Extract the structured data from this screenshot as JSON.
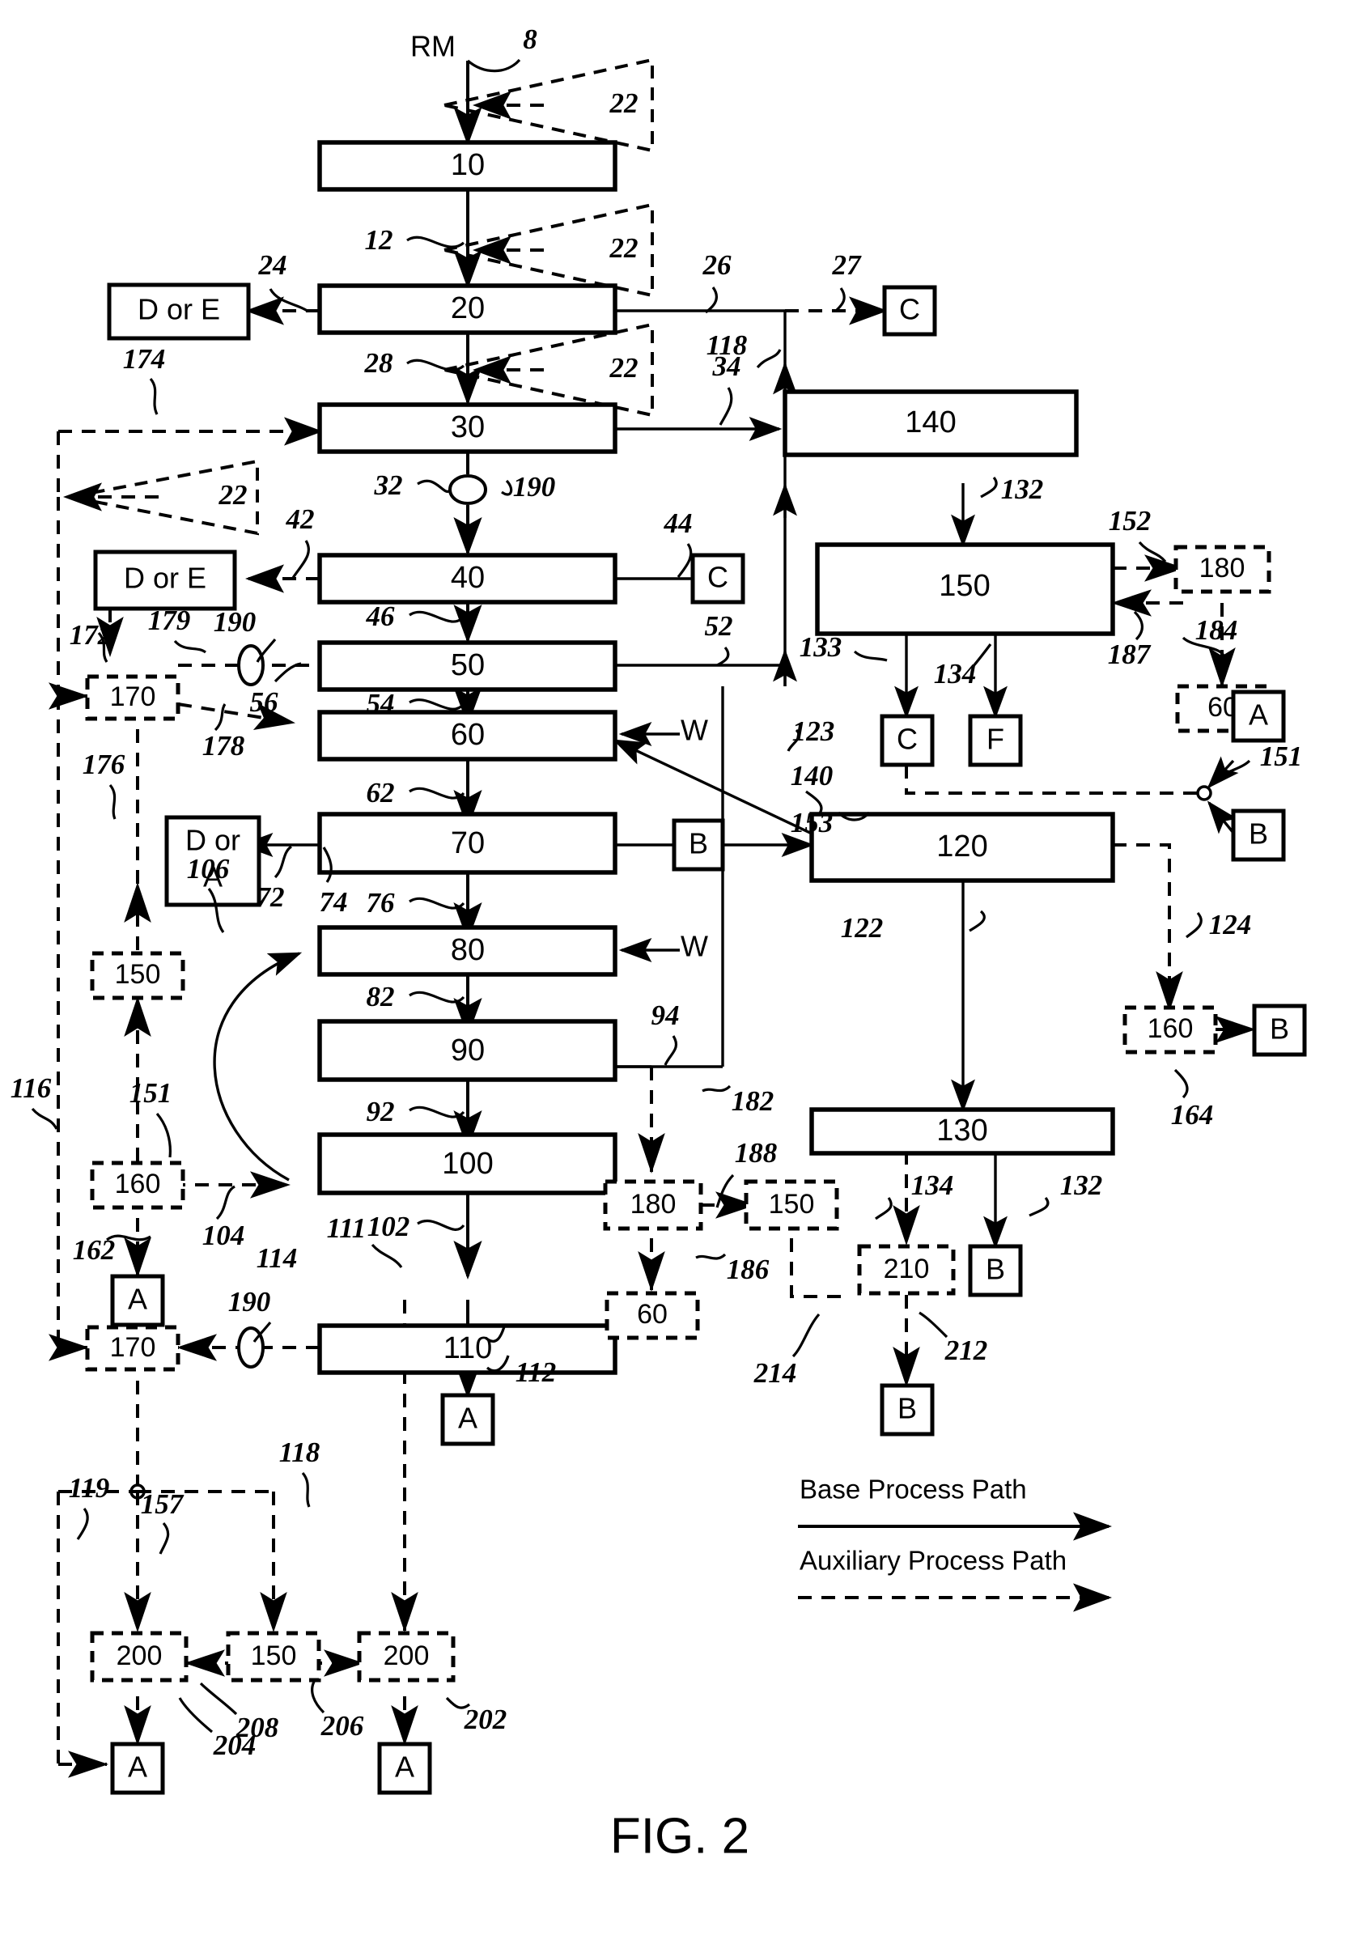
{
  "figure": {
    "caption": "FIG. 2",
    "input_label": "RM"
  },
  "legend": {
    "base_path": "Base Process Path",
    "auxiliary_path": "Auxiliary Process Path"
  },
  "process_boxes": [
    {
      "id": "box-10",
      "label": "10"
    },
    {
      "id": "box-20",
      "label": "20"
    },
    {
      "id": "box-30",
      "label": "30"
    },
    {
      "id": "box-40",
      "label": "40"
    },
    {
      "id": "box-50",
      "label": "50"
    },
    {
      "id": "box-60",
      "label": "60"
    },
    {
      "id": "box-70",
      "label": "70"
    },
    {
      "id": "box-80",
      "label": "80"
    },
    {
      "id": "box-90",
      "label": "90"
    },
    {
      "id": "box-100",
      "label": "100"
    },
    {
      "id": "box-110",
      "label": "110"
    },
    {
      "id": "box-120",
      "label": "120"
    },
    {
      "id": "box-130",
      "label": "130"
    },
    {
      "id": "box-140",
      "label": "140"
    },
    {
      "id": "box-150",
      "label": "150"
    }
  ],
  "dashed_boxes": [
    {
      "id": "dbox-170-upper",
      "label": "170"
    },
    {
      "id": "dbox-170-lower",
      "label": "170"
    },
    {
      "id": "dbox-180-right",
      "label": "180"
    },
    {
      "id": "dbox-180-mid",
      "label": "180"
    },
    {
      "id": "dbox-60-right",
      "label": "60"
    },
    {
      "id": "dbox-60-mid",
      "label": "60"
    },
    {
      "id": "dbox-150-left",
      "label": "150"
    },
    {
      "id": "dbox-150-mid",
      "label": "150"
    },
    {
      "id": "dbox-150-bottom",
      "label": "150"
    },
    {
      "id": "dbox-160-left",
      "label": "160"
    },
    {
      "id": "dbox-160-right",
      "label": "160"
    },
    {
      "id": "dbox-200-left",
      "label": "200"
    },
    {
      "id": "dbox-200-right",
      "label": "200"
    },
    {
      "id": "dbox-210",
      "label": "210"
    }
  ],
  "terminal_boxes": [
    {
      "id": "term-c-top",
      "label": "C"
    },
    {
      "id": "term-c-40",
      "label": "C"
    },
    {
      "id": "term-c-150",
      "label": "C"
    },
    {
      "id": "term-f-150",
      "label": "F"
    },
    {
      "id": "term-b-70",
      "label": "B"
    },
    {
      "id": "term-b-151",
      "label": "B"
    },
    {
      "id": "term-b-160",
      "label": "B"
    },
    {
      "id": "term-b-130",
      "label": "B"
    },
    {
      "id": "term-b-210",
      "label": "B"
    },
    {
      "id": "term-a-151",
      "label": "A"
    },
    {
      "id": "term-a-160left",
      "label": "A"
    },
    {
      "id": "term-a-110",
      "label": "A"
    },
    {
      "id": "term-a-200left",
      "label": "A"
    },
    {
      "id": "term-a-200right",
      "label": "A"
    },
    {
      "id": "term-dore-20",
      "label": "D or E"
    },
    {
      "id": "term-dore-40",
      "label": "D or E"
    },
    {
      "id": "term-dora-70",
      "label": "D or A"
    }
  ],
  "water_labels": [
    {
      "id": "water-60",
      "label": "W"
    },
    {
      "id": "water-80",
      "label": "W"
    }
  ],
  "triangles_22": [
    {
      "id": "tri-22-a",
      "label": "22"
    },
    {
      "id": "tri-22-b",
      "label": "22"
    },
    {
      "id": "tri-22-c",
      "label": "22"
    },
    {
      "id": "tri-22-d",
      "label": "22"
    }
  ],
  "reference_numerals": [
    {
      "id": "ref-8",
      "label": "8"
    },
    {
      "id": "ref-12",
      "label": "12"
    },
    {
      "id": "ref-24",
      "label": "24"
    },
    {
      "id": "ref-26",
      "label": "26"
    },
    {
      "id": "ref-27",
      "label": "27"
    },
    {
      "id": "ref-28",
      "label": "28"
    },
    {
      "id": "ref-32",
      "label": "32"
    },
    {
      "id": "ref-34",
      "label": "34"
    },
    {
      "id": "ref-42",
      "label": "42"
    },
    {
      "id": "ref-44",
      "label": "44"
    },
    {
      "id": "ref-46",
      "label": "46"
    },
    {
      "id": "ref-52",
      "label": "52"
    },
    {
      "id": "ref-54",
      "label": "54"
    },
    {
      "id": "ref-56",
      "label": "56"
    },
    {
      "id": "ref-62",
      "label": "62"
    },
    {
      "id": "ref-72",
      "label": "72"
    },
    {
      "id": "ref-74",
      "label": "74"
    },
    {
      "id": "ref-76",
      "label": "76"
    },
    {
      "id": "ref-82",
      "label": "82"
    },
    {
      "id": "ref-92",
      "label": "92"
    },
    {
      "id": "ref-94",
      "label": "94"
    },
    {
      "id": "ref-102",
      "label": "102"
    },
    {
      "id": "ref-104",
      "label": "104"
    },
    {
      "id": "ref-106",
      "label": "106"
    },
    {
      "id": "ref-111",
      "label": "111"
    },
    {
      "id": "ref-112",
      "label": "112"
    },
    {
      "id": "ref-114",
      "label": "114"
    },
    {
      "id": "ref-116",
      "label": "116"
    },
    {
      "id": "ref-118-top",
      "label": "118"
    },
    {
      "id": "ref-118-bot",
      "label": "118"
    },
    {
      "id": "ref-119",
      "label": "119"
    },
    {
      "id": "ref-122",
      "label": "122"
    },
    {
      "id": "ref-123",
      "label": "123"
    },
    {
      "id": "ref-124",
      "label": "124"
    },
    {
      "id": "ref-132-top",
      "label": "132"
    },
    {
      "id": "ref-132-bot",
      "label": "132"
    },
    {
      "id": "ref-133",
      "label": "133"
    },
    {
      "id": "ref-134-top",
      "label": "134"
    },
    {
      "id": "ref-134-bot",
      "label": "134"
    },
    {
      "id": "ref-140-mid",
      "label": "140"
    },
    {
      "id": "ref-151-right",
      "label": "151"
    },
    {
      "id": "ref-151-left",
      "label": "151"
    },
    {
      "id": "ref-152",
      "label": "152"
    },
    {
      "id": "ref-153",
      "label": "153"
    },
    {
      "id": "ref-157",
      "label": "157"
    },
    {
      "id": "ref-162",
      "label": "162"
    },
    {
      "id": "ref-164",
      "label": "164"
    },
    {
      "id": "ref-172",
      "label": "172"
    },
    {
      "id": "ref-174",
      "label": "174"
    },
    {
      "id": "ref-176",
      "label": "176"
    },
    {
      "id": "ref-178",
      "label": "178"
    },
    {
      "id": "ref-179",
      "label": "179"
    },
    {
      "id": "ref-182",
      "label": "182"
    },
    {
      "id": "ref-184",
      "label": "184"
    },
    {
      "id": "ref-186",
      "label": "186"
    },
    {
      "id": "ref-187",
      "label": "187"
    },
    {
      "id": "ref-188",
      "label": "188"
    },
    {
      "id": "ref-190-a",
      "label": "190"
    },
    {
      "id": "ref-190-b",
      "label": "190"
    },
    {
      "id": "ref-190-c",
      "label": "190"
    },
    {
      "id": "ref-202",
      "label": "202"
    },
    {
      "id": "ref-204",
      "label": "204"
    },
    {
      "id": "ref-206",
      "label": "206"
    },
    {
      "id": "ref-208",
      "label": "208"
    },
    {
      "id": "ref-212",
      "label": "212"
    },
    {
      "id": "ref-214",
      "label": "214"
    }
  ],
  "colors": {
    "ink": "#000000",
    "paper": "#ffffff"
  }
}
